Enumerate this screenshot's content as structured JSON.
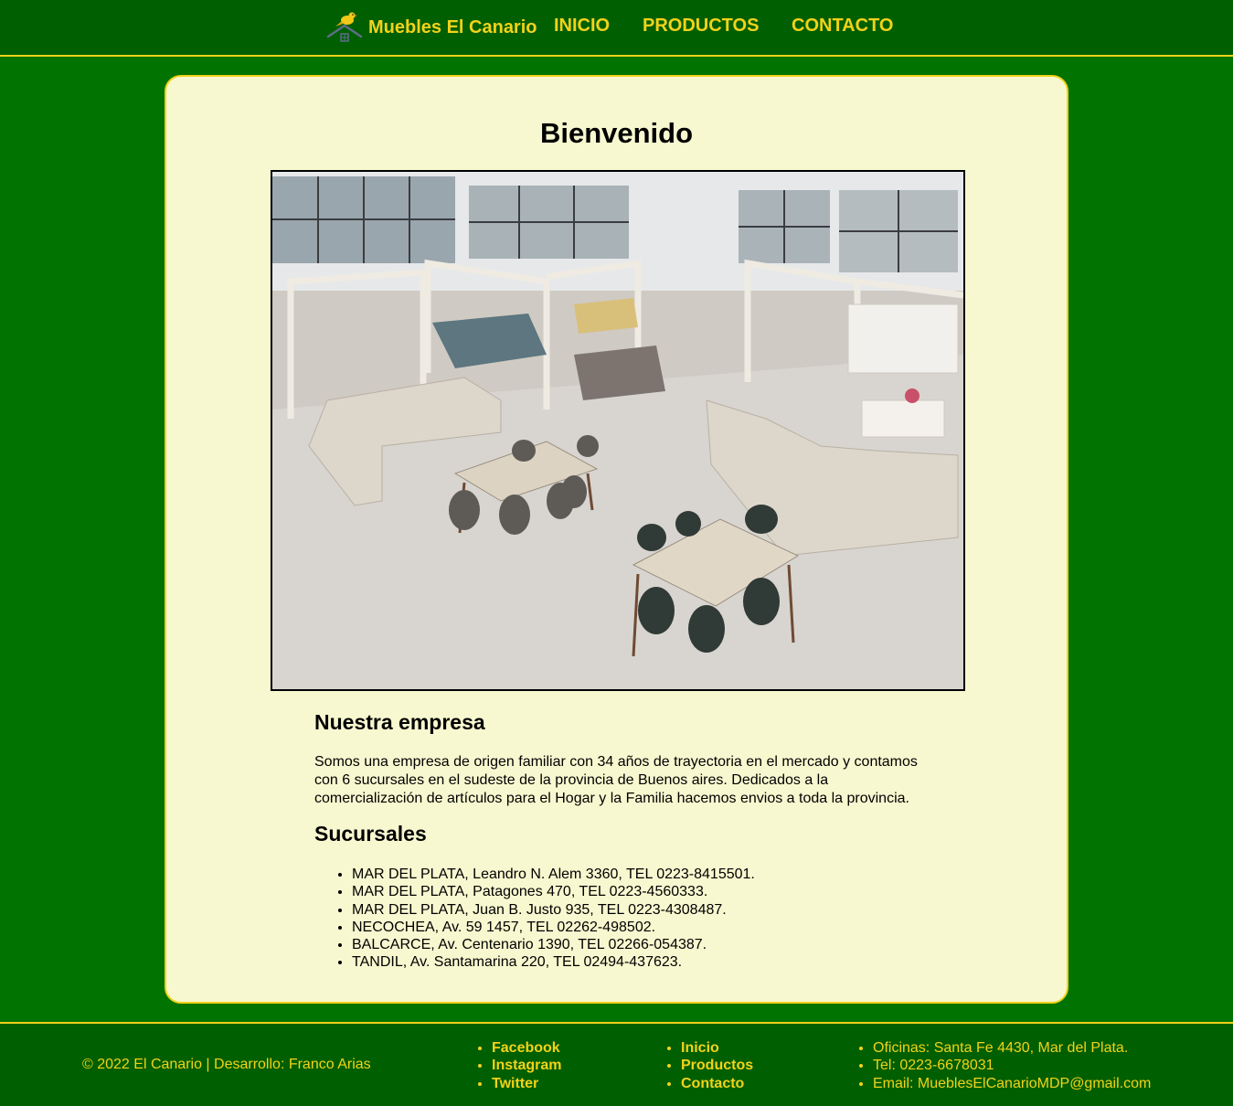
{
  "colors": {
    "page_bg": "#007300",
    "bar_bg": "#005f00",
    "accent": "#f2d21a",
    "card_bg": "#f8f8d0"
  },
  "header": {
    "logo_icon": "canary-bird-house-icon",
    "brand": "Muebles El Canario",
    "nav": [
      "INICIO",
      "PRODUCTOS",
      "CONTACTO"
    ]
  },
  "main": {
    "title": "Bienvenido",
    "about": {
      "heading": "Nuestra empresa",
      "text": "Somos una empresa de origen familiar con 34 años de trayectoria en el mercado y contamos con 6 sucursales en el sudeste de la provincia de Buenos aires. Dedicados a la comercialización de artículos para el Hogar y la Familia hacemos envios a toda la provincia."
    },
    "branches": {
      "heading": "Sucursales",
      "items": [
        "MAR DEL PLATA, Leandro N. Alem 3360, TEL 0223-8415501.",
        "MAR DEL PLATA, Patagones 470, TEL 0223-4560333.",
        "MAR DEL PLATA, Juan B. Justo 935, TEL 0223-4308487.",
        "NECOCHEA, Av. 59 1457, TEL 02262-498502.",
        "BALCARCE, Av. Centenario 1390, TEL 02266-054387.",
        "TANDIL, Av. Santamarina 220, TEL 02494-437623."
      ]
    }
  },
  "footer": {
    "copyright": "© 2022 El Canario | Desarrollo: Franco Arias",
    "social": [
      "Facebook",
      "Instagram",
      "Twitter"
    ],
    "links": [
      "Inicio",
      "Productos",
      "Contacto"
    ],
    "contact": [
      "Oficinas: Santa Fe 4430, Mar del Plata.",
      "Tel: 0223-6678031",
      "Email: MueblesElCanarioMDP@gmail.com"
    ]
  }
}
